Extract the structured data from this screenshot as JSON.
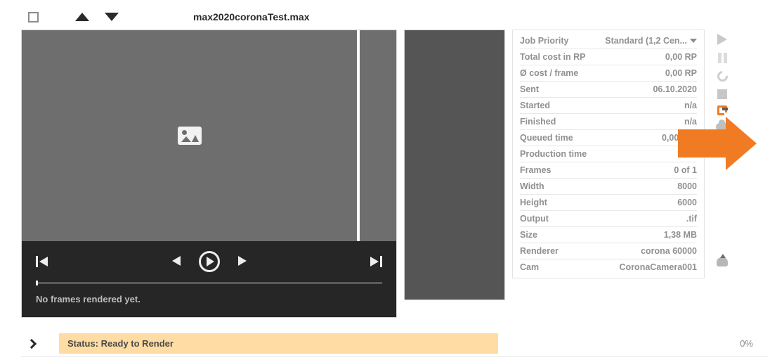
{
  "titlebar": {
    "filename": "max2020coronaTest.max"
  },
  "preview": {
    "status": "No frames rendered yet."
  },
  "info": {
    "priority_label": "Job Priority",
    "priority_value": "Standard (1,2 Cen...",
    "rows": [
      {
        "label": "Total cost in RP",
        "value": "0,00 RP"
      },
      {
        "label": "Ø cost / frame",
        "value": "0,00 RP"
      },
      {
        "label": "Sent",
        "value": "06.10.2020"
      },
      {
        "label": "Started",
        "value": "n/a"
      },
      {
        "label": "Finished",
        "value": "n/a"
      },
      {
        "label": "Queued time",
        "value": "0,00 min"
      },
      {
        "label": "Production time",
        "value": ""
      },
      {
        "label": "Frames",
        "value": "0 of 1"
      },
      {
        "label": "Width",
        "value": "8000"
      },
      {
        "label": "Height",
        "value": "6000"
      },
      {
        "label": "Output",
        "value": ".tif"
      },
      {
        "label": "Size",
        "value": "1,38 MB"
      },
      {
        "label": "Renderer",
        "value": "corona 60000"
      },
      {
        "label": "Cam",
        "value": "CoronaCamera001"
      }
    ]
  },
  "footer": {
    "status_prefix": "Status: ",
    "status_value": "Ready to Render",
    "progress": "0%"
  },
  "icons": {
    "play": "play-icon",
    "pause": "pause-icon",
    "refresh": "refresh-icon",
    "stop": "stop-icon",
    "open": "open-folder-icon",
    "cloud": "cloud-icon",
    "disk": "disk-icon",
    "upload": "upload-icon"
  }
}
